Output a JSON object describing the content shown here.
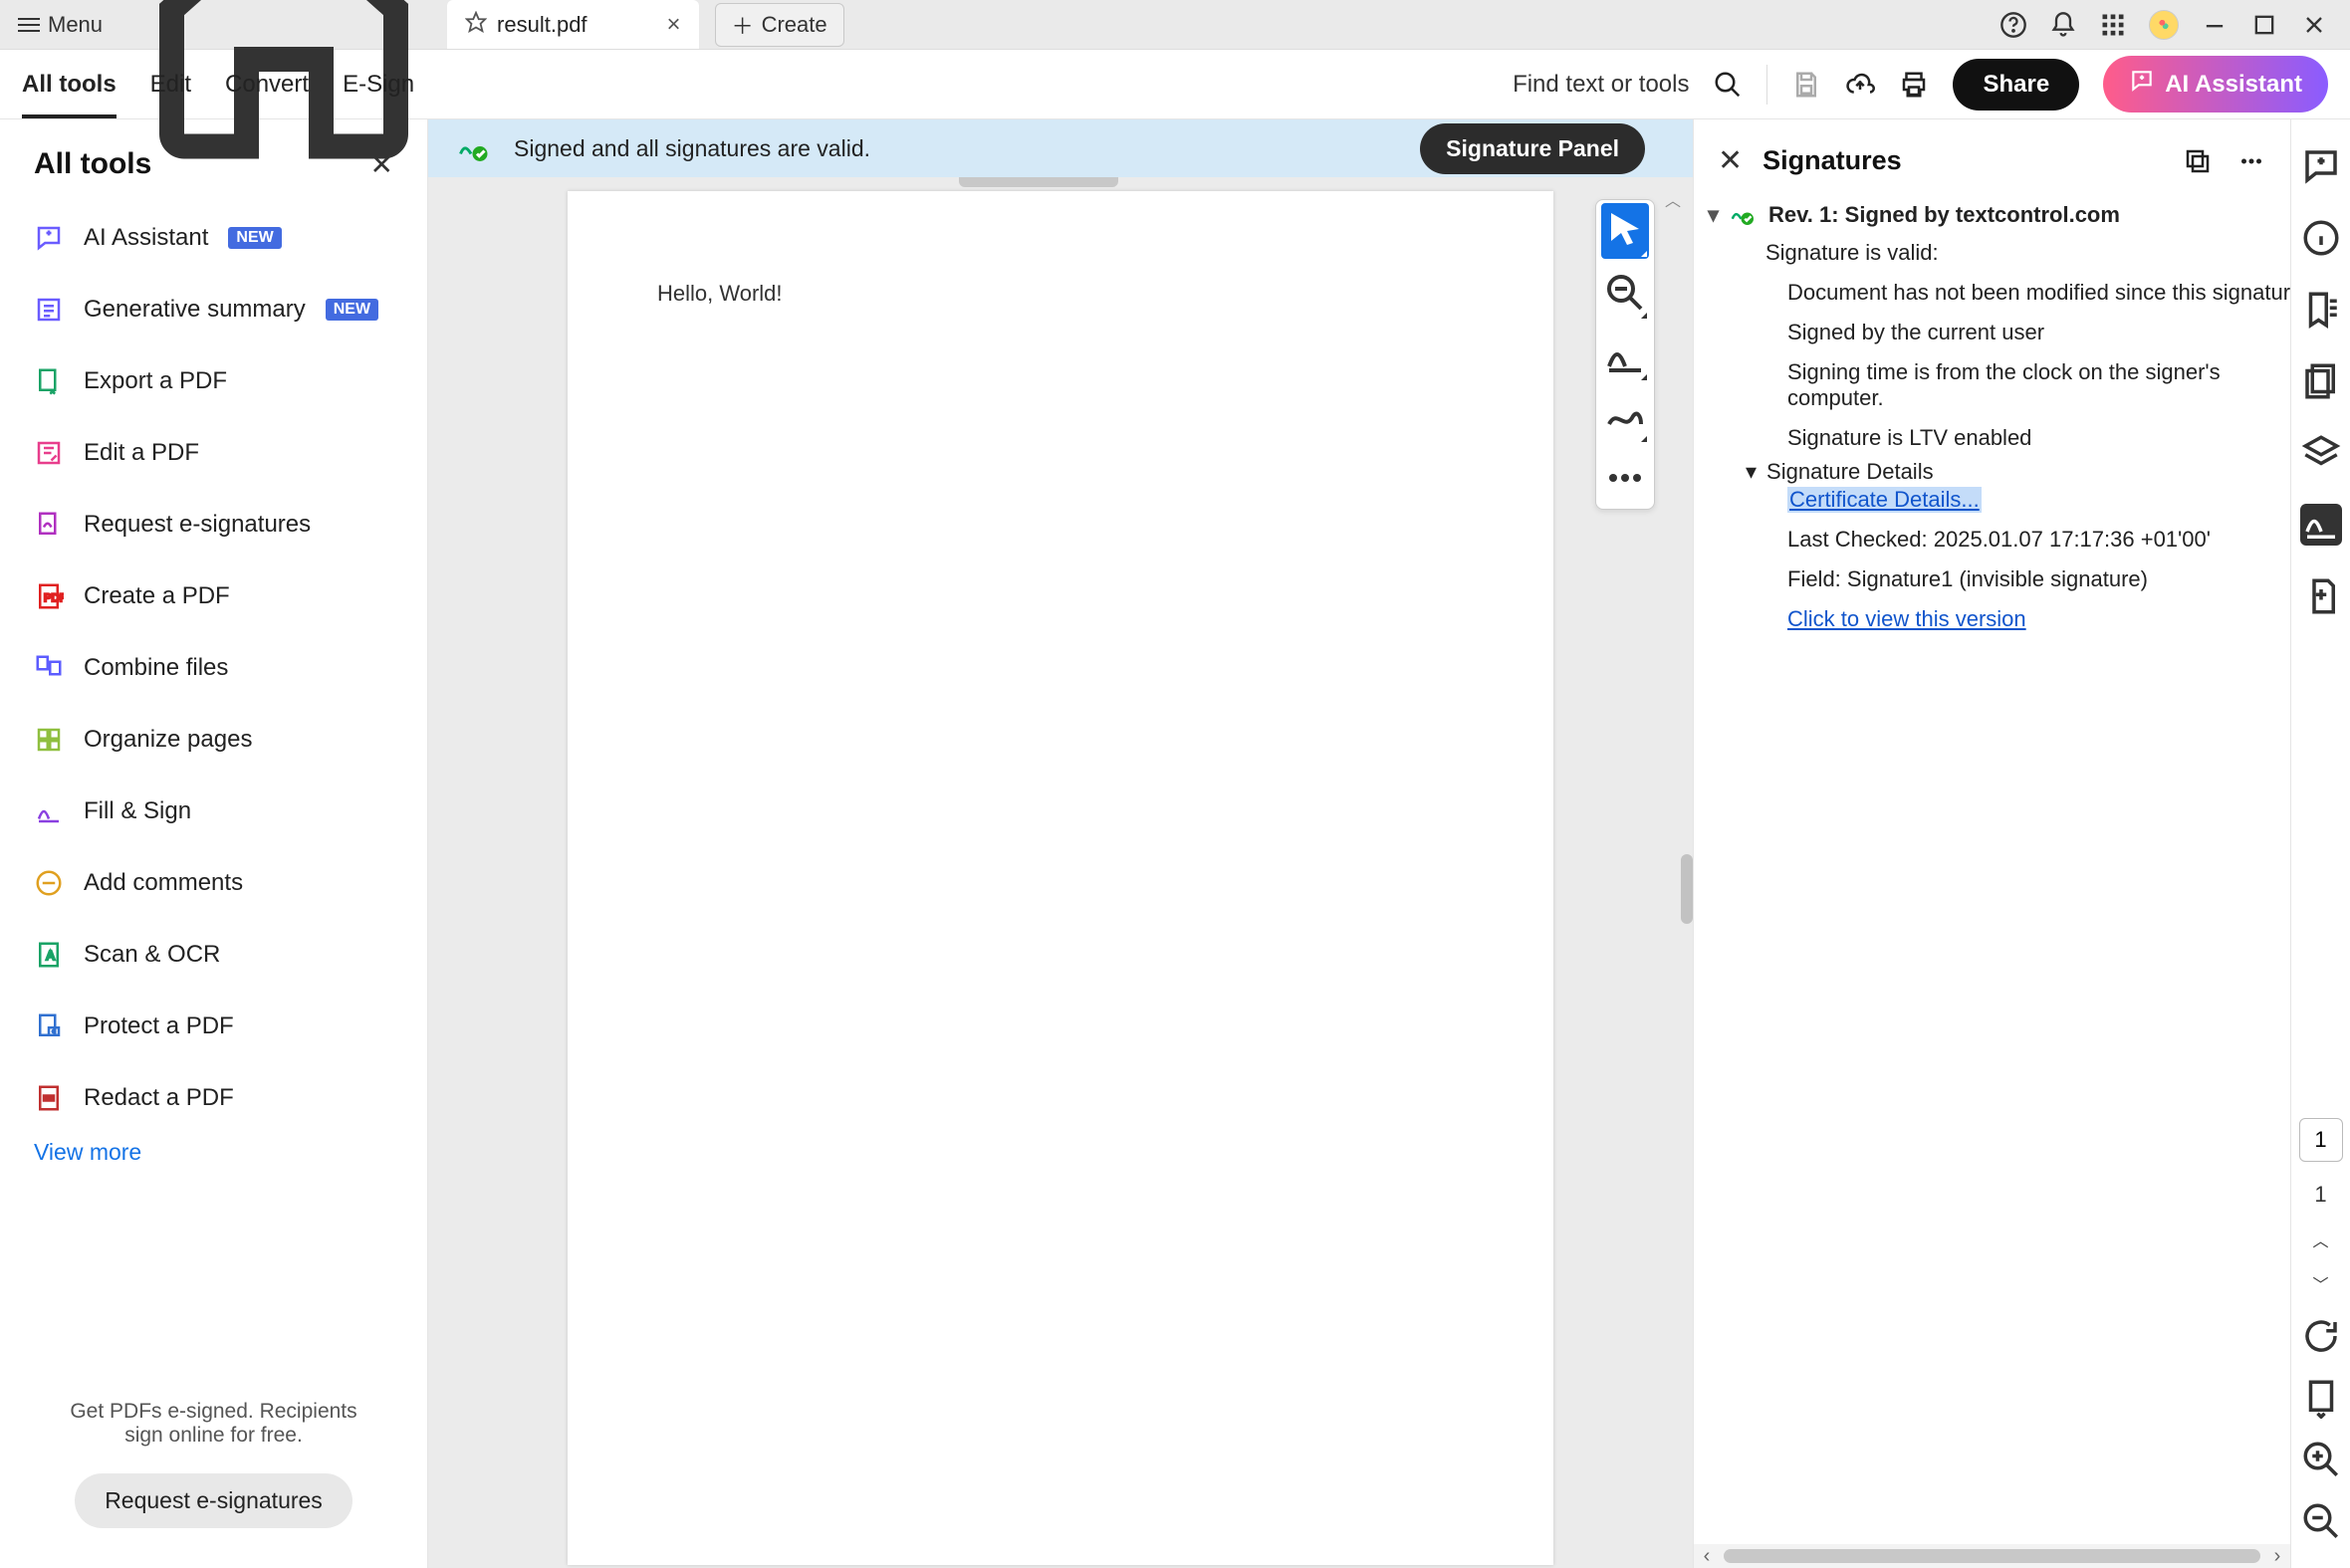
{
  "titlebar": {
    "menu": "Menu",
    "tab_name": "result.pdf",
    "create": "Create"
  },
  "toolbar": {
    "tabs": [
      "All tools",
      "Edit",
      "Convert",
      "E-Sign"
    ],
    "find": "Find text or tools",
    "share": "Share",
    "ai": "AI Assistant"
  },
  "sidebar": {
    "title": "All tools",
    "items": [
      {
        "label": "AI Assistant",
        "badge": "NEW",
        "color": "#6a5cff"
      },
      {
        "label": "Generative summary",
        "badge": "NEW",
        "color": "#6a5cff"
      },
      {
        "label": "Export a PDF",
        "color": "#1aa366"
      },
      {
        "label": "Edit a PDF",
        "color": "#e83e8c"
      },
      {
        "label": "Request e-signatures",
        "color": "#b030c0"
      },
      {
        "label": "Create a PDF",
        "color": "#e02020"
      },
      {
        "label": "Combine files",
        "color": "#5c5cff"
      },
      {
        "label": "Organize pages",
        "color": "#8fbf3f"
      },
      {
        "label": "Fill & Sign",
        "color": "#8a40e0"
      },
      {
        "label": "Add comments",
        "color": "#e0a020"
      },
      {
        "label": "Scan & OCR",
        "color": "#1aa366"
      },
      {
        "label": "Protect a PDF",
        "color": "#3070d0"
      },
      {
        "label": "Redact a PDF",
        "color": "#c03030"
      }
    ],
    "view_more": "View more",
    "promo": "Get PDFs e-signed. Recipients sign online for free.",
    "promo_btn": "Request e-signatures"
  },
  "banner_text": "Signed and all signatures are valid.",
  "sig_panel_btn": "Signature Panel",
  "document_text": "Hello, World!",
  "signatures": {
    "title": "Signatures",
    "rev": "Rev. 1: Signed by textcontrol.com",
    "valid": "Signature is valid:",
    "l1": "Document has not been modified since this signature was applied",
    "l2": "Signed by the current user",
    "l3": "Signing time is from the clock on the signer's computer.",
    "l4": "Signature is LTV enabled",
    "details": "Signature Details",
    "cert": "Certificate Details...",
    "last": "Last Checked: 2025.01.07 17:17:36 +01'00'",
    "field": "Field: Signature1 (invisible signature)",
    "click": "Click to view this version"
  },
  "page_current": "1",
  "page_total": "1"
}
